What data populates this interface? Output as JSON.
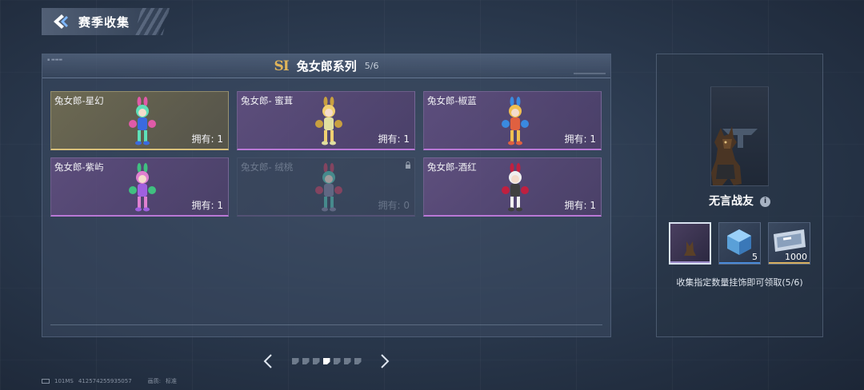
{
  "header": {
    "title": "赛季收集",
    "back_icon": "back-arrow-icon"
  },
  "series": {
    "season_badge": "SI",
    "title": "兔女郎系列",
    "progress": "5/6"
  },
  "cards": [
    {
      "name": "兔女郎-星幻",
      "count": "拥有: 1",
      "style": "gold",
      "colors": [
        "#5ee0b8",
        "#e05aa8",
        "#3a6ae0"
      ]
    },
    {
      "name": "兔女郎- 蜜茸",
      "count": "拥有: 1",
      "style": "purple",
      "colors": [
        "#f0d070",
        "#c8a040",
        "#e0e0a0"
      ]
    },
    {
      "name": "兔女郎-椒蓝",
      "count": "拥有: 1",
      "style": "purple",
      "colors": [
        "#f0c050",
        "#3a8ae0",
        "#e06040"
      ]
    },
    {
      "name": "兔女郎-紫屿",
      "count": "拥有: 1",
      "style": "purple",
      "colors": [
        "#e080d0",
        "#40c080",
        "#a060e0"
      ]
    },
    {
      "name": "兔女郎- 绒桃",
      "count": "拥有: 0",
      "style": "locked",
      "colors": [
        "#50c0b0",
        "#c04060",
        "#8080a0"
      ]
    },
    {
      "name": "兔女郎-酒红",
      "count": "拥有: 1",
      "style": "purple",
      "colors": [
        "#f0f0f0",
        "#c02040",
        "#404040"
      ]
    }
  ],
  "pagination": {
    "pages": 7,
    "active_index": 3
  },
  "reward": {
    "name": "无言战友",
    "info_icon": "i",
    "items": [
      {
        "qty": "",
        "bar_color": "#9a8ac8"
      },
      {
        "qty": "5",
        "bar_color": "#4a8ad8"
      },
      {
        "qty": "1000",
        "bar_color": "#d8b060"
      }
    ],
    "description": "收集指定数量挂饰即可领取(5/6)"
  },
  "footer": {
    "ping": "101MS",
    "uid": "412574255935057",
    "quality_label": "画质:",
    "quality_value": "标准"
  }
}
